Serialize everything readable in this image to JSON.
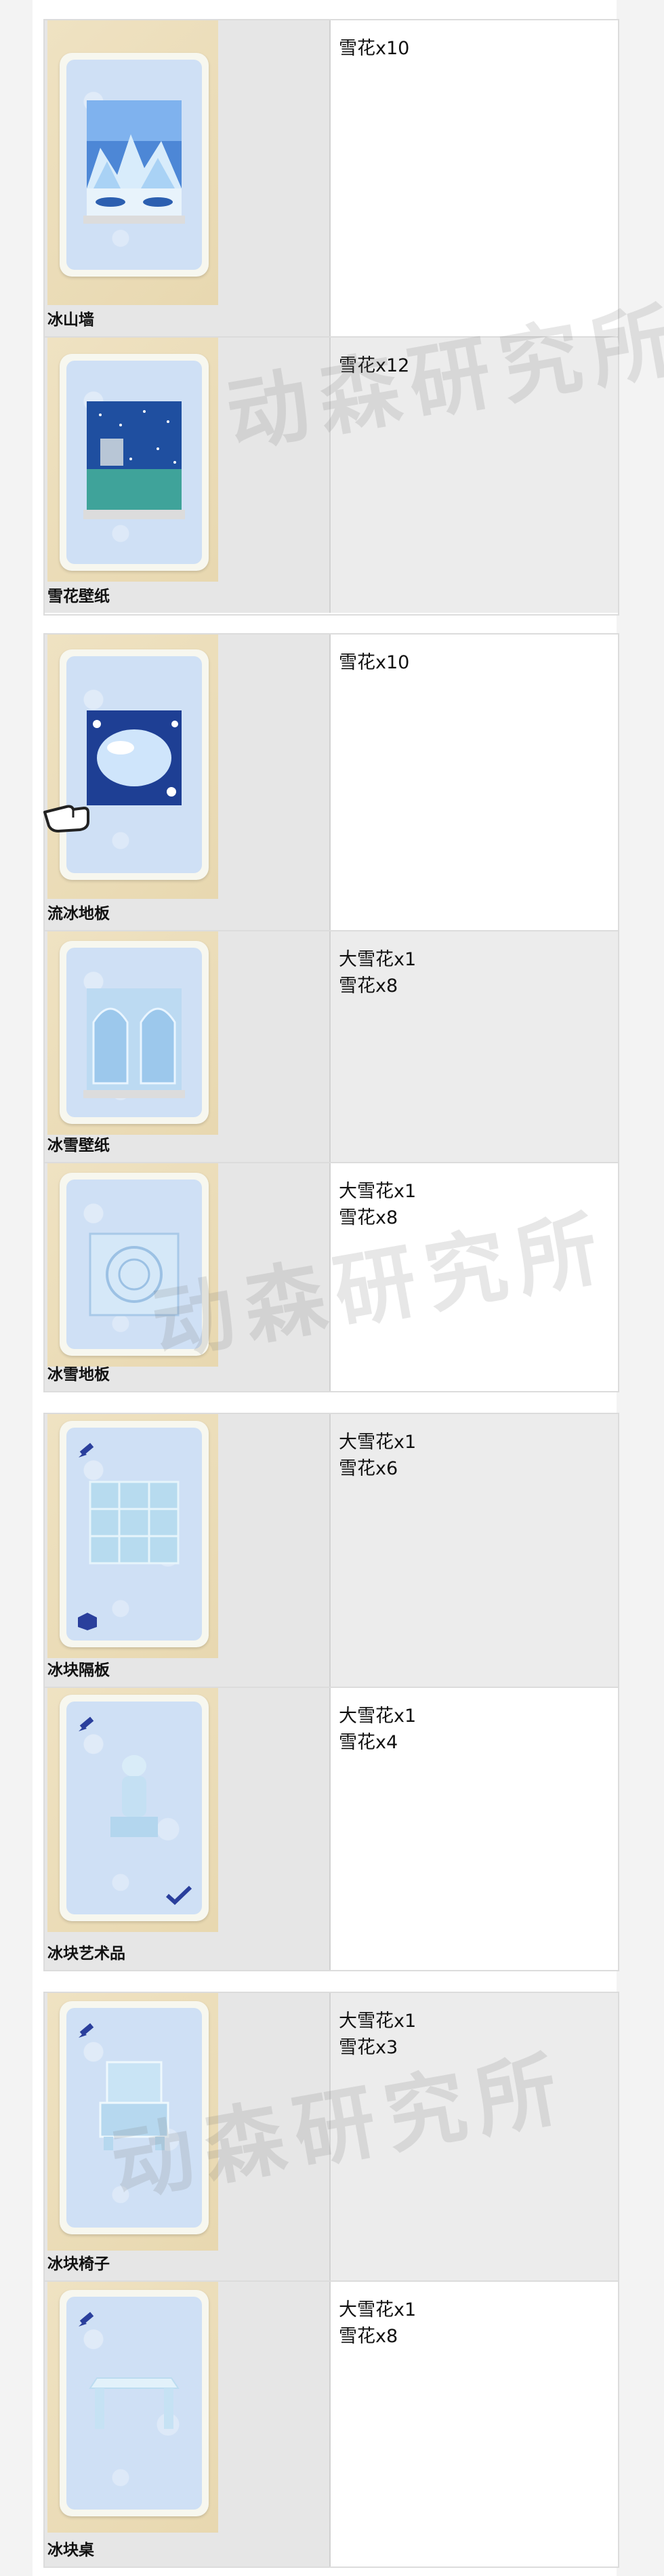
{
  "watermark": "动森研究所",
  "groups": [
    {
      "rows": [
        {
          "name": "冰山墙",
          "materials": "雪花x10"
        },
        {
          "name": "雪花壁纸",
          "materials": "雪花x12"
        }
      ]
    },
    {
      "rows": [
        {
          "name": "流冰地板",
          "materials": "雪花x10"
        },
        {
          "name": "冰雪壁纸",
          "materials": "大雪花x1\n雪花x8"
        },
        {
          "name": "冰雪地板",
          "materials": "大雪花x1\n雪花x8"
        }
      ]
    },
    {
      "rows": [
        {
          "name": "冰块隔板",
          "materials": "大雪花x1\n雪花x6"
        },
        {
          "name": "冰块艺术品",
          "materials": "大雪花x1\n雪花x4"
        }
      ]
    },
    {
      "rows": [
        {
          "name": "冰块椅子",
          "materials": "大雪花x1\n雪花x3"
        },
        {
          "name": "冰块桌",
          "materials": "大雪花x1\n雪花x8"
        }
      ]
    }
  ]
}
